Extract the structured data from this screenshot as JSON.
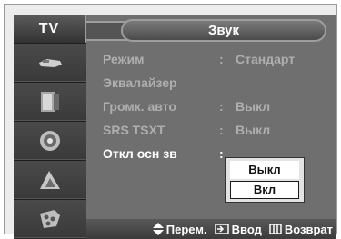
{
  "sidebar": {
    "title": "TV",
    "icons": [
      "picture-icon",
      "sound-icon",
      "channel-icon",
      "setup-icon",
      "input-icon"
    ]
  },
  "header": {
    "title": "Звук"
  },
  "menu": {
    "items": [
      {
        "label": "Режим",
        "colon": ":",
        "value": "Стандарт"
      },
      {
        "label": "Эквалайзер",
        "colon": "",
        "value": ""
      },
      {
        "label": "Громк. авто",
        "colon": ":",
        "value": "Выкл"
      },
      {
        "label": "SRS TSXT",
        "colon": ":",
        "value": "Выкл"
      },
      {
        "label": "Откл осн зв",
        "colon": ":",
        "value": ""
      }
    ]
  },
  "dropdown": {
    "options": [
      "Выкл",
      "Вкл"
    ],
    "selected": "Выкл"
  },
  "footer": {
    "move": "Перем.",
    "enter": "Ввод",
    "return": "Возврат"
  }
}
